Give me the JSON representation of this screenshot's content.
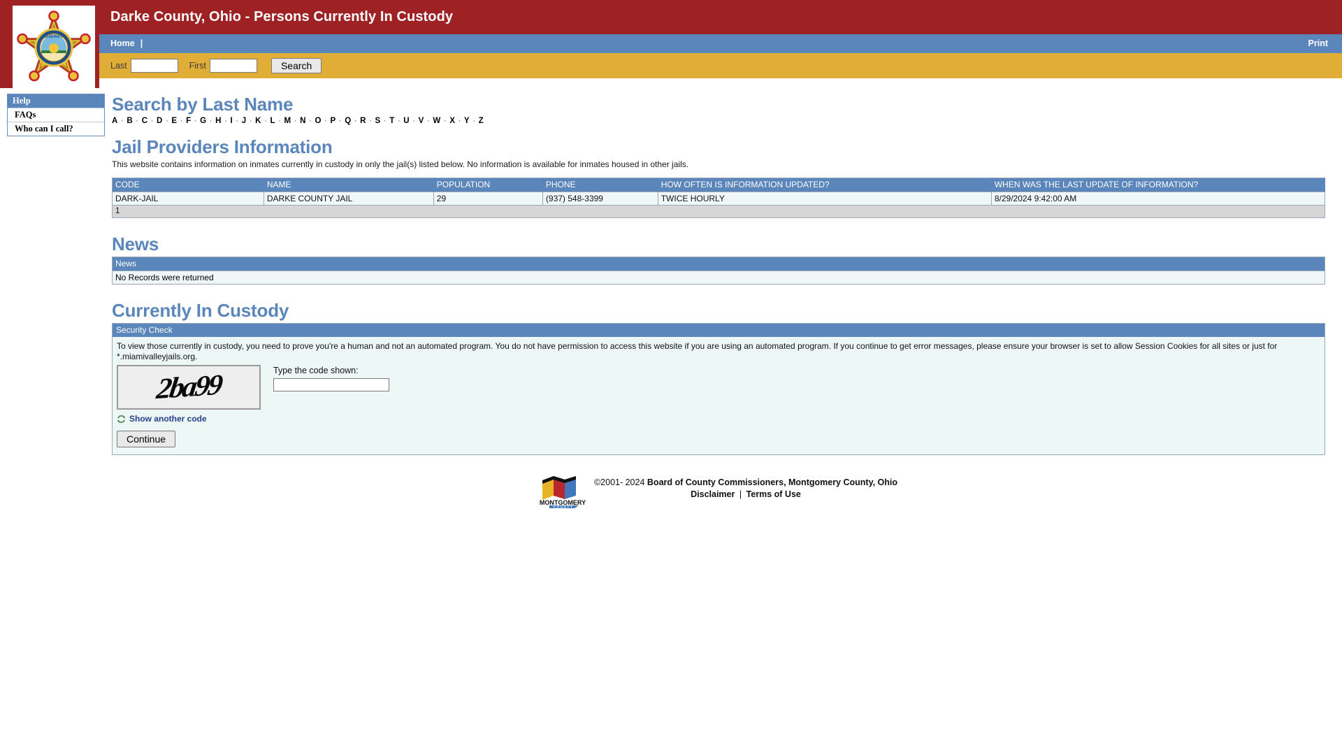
{
  "header": {
    "title": "Darke County, Ohio - Persons Currently In Custody",
    "nav": {
      "home_label": "Home",
      "separator": "|",
      "print_label": "Print"
    },
    "search": {
      "last_label": "Last",
      "last_value": "",
      "first_label": "First",
      "first_value": "",
      "button_label": "Search"
    },
    "badge_alt": "sheriff-badge"
  },
  "sidebar": {
    "heading": "Help",
    "items": [
      {
        "label": "FAQs"
      },
      {
        "label": "Who can I call?"
      }
    ]
  },
  "search_by_last_name": {
    "title": "Search by Last Name",
    "letters": [
      "A",
      "B",
      "C",
      "D",
      "E",
      "F",
      "G",
      "H",
      "I",
      "J",
      "K",
      "L",
      "M",
      "N",
      "O",
      "P",
      "Q",
      "R",
      "S",
      "T",
      "U",
      "V",
      "W",
      "X",
      "Y",
      "Z"
    ],
    "separator": "·"
  },
  "jail_providers": {
    "title": "Jail Providers Information",
    "blurb": "This website contains information on inmates currently in custody in only the jail(s) listed below. No information is available for inmates housed in other jails.",
    "columns": [
      "CODE",
      "NAME",
      "POPULATION",
      "PHONE",
      "HOW OFTEN IS INFORMATION UPDATED?",
      "WHEN WAS THE LAST UPDATE OF INFORMATION?"
    ],
    "rows": [
      {
        "code": "DARK-JAIL",
        "name": "DARKE COUNTY JAIL",
        "population": "29",
        "phone": "(937) 548-3399",
        "update_frequency": "TWICE HOURLY",
        "last_update": "8/29/2024 9:42:00 AM"
      }
    ],
    "pager": "1"
  },
  "news": {
    "title": "News",
    "column": "News",
    "empty_message": "No Records were returned"
  },
  "custody": {
    "title": "Currently In Custody",
    "security_check": {
      "panel_title": "Security Check",
      "instructions": "To view those currently in custody, you need to prove you're a human and not an automated program. You do not have permission to access this website if you are using an automated program. If you continue to get error messages, please ensure your browser is set to allow Session Cookies for all sites or just for *.miamivalleyjails.org.",
      "captcha_code": "2ba99",
      "code_label": "Type the code shown:",
      "code_value": "",
      "refresh_label": "Show another code",
      "continue_label": "Continue"
    }
  },
  "footer": {
    "copyright": "©2001- 2024",
    "org": "Board of County Commissioners, Montgomery County, Ohio",
    "disclaimer_label": "Disclaimer",
    "links_separator": "|",
    "terms_label": "Terms of Use",
    "logo_text": "MONTGOMERY",
    "logo_subtext": "C O U N T Y"
  },
  "colors": {
    "brand_red": "#9e2124",
    "nav_blue": "#5b86bb",
    "search_gold": "#e0ad36",
    "heading_blue": "#5b86bb",
    "row_bg": "#f0f7f7",
    "pager_bg": "#d6d6d6"
  }
}
